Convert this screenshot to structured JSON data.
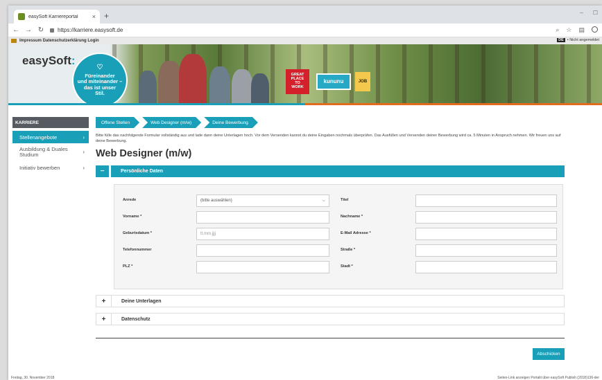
{
  "browser": {
    "tab_title": "easySoft Karriereportal",
    "tab_close": "×",
    "new_tab": "+",
    "url": "https://karriere.easysoft.de"
  },
  "sitebar": {
    "links": "Impressum  Datenschutzerklärung  Login",
    "lang": "DE",
    "login_status": "• Nicht angemeldet"
  },
  "banner": {
    "logo": "easySoft",
    "logo_colon": ":",
    "slogan_lines": [
      "Füreinander",
      "und miteinander –",
      "das ist unser",
      "Stil."
    ],
    "award_gptw": [
      "GREAT",
      "PLACE",
      "TO",
      "WORK"
    ],
    "award_kununu": "kununu",
    "award_job": "JOB"
  },
  "sidebar": {
    "header": "KARRIERE",
    "items": [
      {
        "label": "Stellenangebote",
        "active": true
      },
      {
        "label": "Ausbildung & Duales Studium",
        "active": false
      },
      {
        "label": "Initiativ bewerben",
        "active": false
      }
    ],
    "chevron": "›"
  },
  "breadcrumbs": [
    "Offene Stellen",
    "Web Designer (m/w)",
    "Deine Bewerbung"
  ],
  "intro": "Bitte fülle das nachfolgende Formular vollständig aus und lade dann deine Unterlagen hoch. Vor dem Versenden kannst du deine Eingaben nochmals überprüfen. Das Ausfüllen und Versenden deiner Bewerbung wird ca. 5 Minuten in Anspruch nehmen. Wir freuen uns auf deine Bewerbung.",
  "page_title": "Web Designer (m/w)",
  "sections": {
    "personal": {
      "toggle": "−",
      "label": "Persönliche Daten"
    },
    "documents": {
      "toggle": "+",
      "label": "Deine Unterlagen"
    },
    "privacy": {
      "toggle": "+",
      "label": "Datenschutz"
    }
  },
  "form": {
    "anrede_label": "Anrede",
    "anrede_value": "(bitte auswählen)",
    "titel_label": "Titel",
    "vorname_label": "Vorname *",
    "nachname_label": "Nachname *",
    "geburtsdatum_label": "Geburtsdatum *",
    "geburtsdatum_placeholder": "tt.mm.jjjj",
    "email_label": "E-Mail Adresse *",
    "telefon_label": "Telefonnummer",
    "strasse_label": "Straße *",
    "plz_label": "PLZ *",
    "stadt_label": "Stadt *"
  },
  "submit_label": "Abschicken",
  "footer": {
    "left": "Freitag, 30. November 2018",
    "right": "Seiten-Link anzeigen  Portalit über easySoft  Publish (2018)136-der"
  }
}
